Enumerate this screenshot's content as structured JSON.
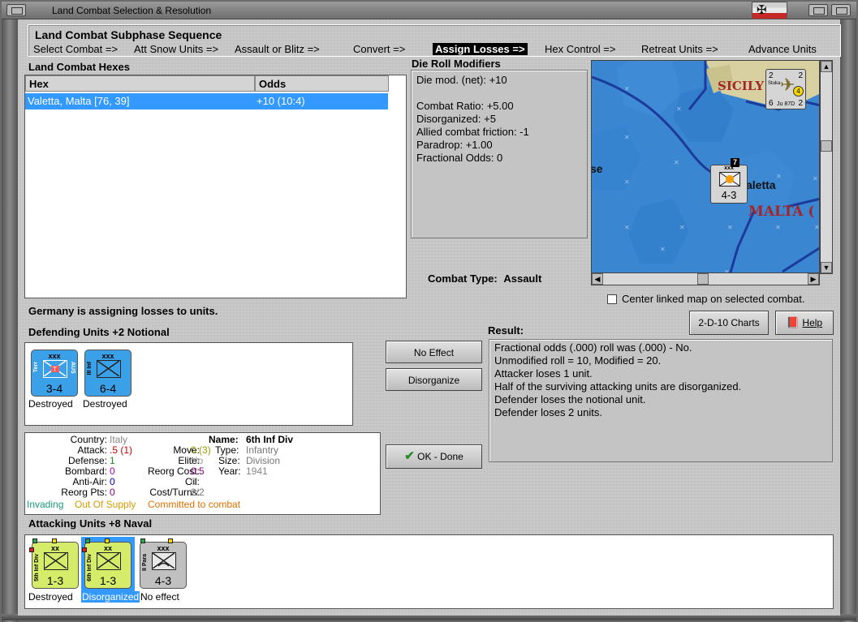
{
  "window": {
    "title": "Land Combat Selection & Resolution"
  },
  "subphase": {
    "header": "Land Combat Subphase Sequence",
    "items": [
      "Select Combat =>",
      "Att Snow Units =>",
      "Assault or Blitz =>",
      "Convert =>",
      "Assign Losses =>",
      "Hex Control =>",
      "Retreat Units =>",
      "Advance Units"
    ],
    "active_index": 4
  },
  "hexes": {
    "label": "Land Combat Hexes",
    "columns": [
      "Hex",
      "Odds"
    ],
    "rows": [
      {
        "hex": "Valetta, Malta [76, 39]",
        "odds": "+10 (10:4)"
      }
    ]
  },
  "drm": {
    "label": "Die Roll Modifiers",
    "lines": [
      "Die mod. (net): +10",
      "",
      "Combat Ratio: +5.00",
      "Disorganized: +5",
      "Allied combat friction: -1",
      "Paradrop: +1.00",
      "Fractional Odds: 0"
    ]
  },
  "combat_type": {
    "label": "Combat Type:",
    "value": "Assault"
  },
  "map": {
    "labels": {
      "sicily": "SICILY",
      "malta": "MALTA (",
      "valetta": "aletta",
      "se": "se"
    },
    "unit_top_right": {
      "tag": "Stuka",
      "code": "Ju 87D",
      "n1": "2",
      "n2": "2",
      "n3": "6",
      "n4": "2",
      "badge": "4"
    },
    "malta_unit": {
      "stack": "7",
      "vals": "4-3",
      "size": "xxx"
    }
  },
  "center_map": {
    "label": "Center linked map on selected combat."
  },
  "buttons": {
    "charts": "2-D-10 Charts",
    "help": "Help",
    "no_effect": "No Effect",
    "disorganize": "Disorganize",
    "ok_done": "OK - Done"
  },
  "status": "Germany is assigning losses to units.",
  "defending": {
    "label": "Defending Units +2 Notional",
    "units": [
      {
        "size": "xxx",
        "left_text": "Terr",
        "right_text": "AUS",
        "vals": "3-4",
        "caption": "Destroyed",
        "type": "terr"
      },
      {
        "size": "xxx",
        "left_text": "III Inf",
        "right_text": "",
        "vals": "6-4",
        "caption": "Destroyed",
        "type": "inf"
      }
    ]
  },
  "result": {
    "label": "Result:",
    "lines": [
      "Fractional odds (.000) roll was (.000)  - No.",
      "Unmodified roll = 10, Modified = 20.",
      "Attacker loses 1 unit.",
      "Half of the surviving attacking units are disorganized.",
      "Defender loses the notional unit.",
      "Defender loses 2 units."
    ]
  },
  "info": {
    "country_label": "Country:",
    "country": "Italy",
    "name_label": "Name:",
    "name": "6th Inf Div",
    "attack_label": "Attack:",
    "attack": ".5",
    "attack_paren": "(1)",
    "move_label": "Move:",
    "move": "0",
    "move_paren": "(3)",
    "type_label": "Type:",
    "type": "Infantry",
    "defense_label": "Defense:",
    "defense": "1",
    "elite_label": "Elite:",
    "elite": "No",
    "size_label": "Size:",
    "size": "Division",
    "bombard_label": "Bombard:",
    "bombard": "0",
    "reorg_cost_label": "Reorg Cost:",
    "reorg_cost": "0.5",
    "year_label": "Year:",
    "year": "1941",
    "aa_label": "Anti-Air:",
    "aa": "0",
    "oil_label": "Oil:",
    "oil": "0",
    "reorg_pts_label": "Reorg Pts:",
    "reorg_pts": "0",
    "cost_label": "Cost/Turns:",
    "cost": "2/2",
    "status1": "Invading",
    "status2": "Out Of Supply",
    "status3": "Committed to combat"
  },
  "attacking": {
    "label": "Attacking Units +8 Naval",
    "units": [
      {
        "size": "xx",
        "side_text": "5th Inf Div",
        "vals": "1-3",
        "caption": "Destroyed",
        "color": "#d4ec6a",
        "selected": false
      },
      {
        "size": "xx",
        "side_text": "6th Inf Div",
        "vals": "1-3",
        "caption": "Disorganized",
        "color": "#d4ec6a",
        "selected": true
      },
      {
        "size": "xxx",
        "side_text": "II Para",
        "vals": "4-3",
        "caption": "No effect",
        "color": "#c0c0c0",
        "selected": false
      }
    ]
  },
  "colors": {
    "selection": "#3399ff",
    "defender_unit": "#3aa0e8",
    "attacker_unit": "#d4ec6a",
    "para_unit": "#c0c0c0",
    "sea": "#3a86d1",
    "land": "#d8d0a0"
  }
}
